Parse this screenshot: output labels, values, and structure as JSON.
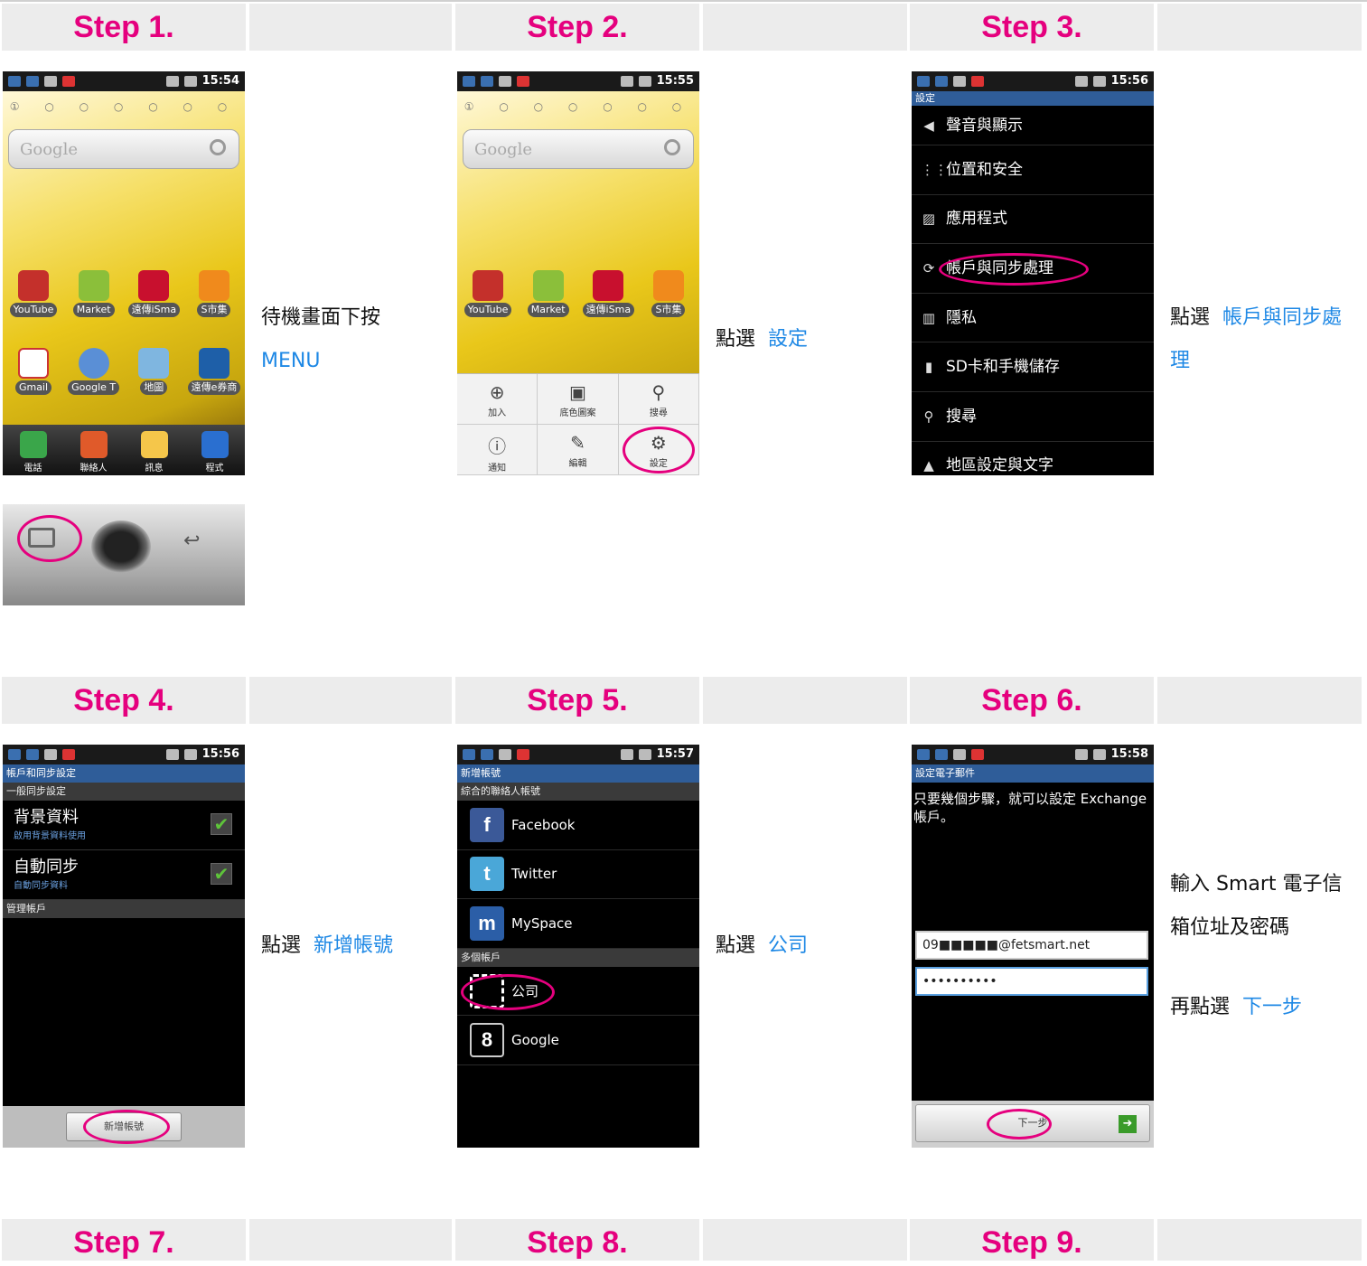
{
  "steps": [
    {
      "title": "Step 1.",
      "caption_prefix": "待機畫面下按",
      "caption_link": "MENU"
    },
    {
      "title": "Step 2.",
      "caption_prefix": "點選",
      "caption_link": "設定"
    },
    {
      "title": "Step 3.",
      "caption_prefix": "點選",
      "caption_link": "帳戶與同步處理"
    },
    {
      "title": "Step 4.",
      "caption_prefix": "點選",
      "caption_link": "新增帳號"
    },
    {
      "title": "Step 5.",
      "caption_prefix": "點選",
      "caption_link": "公司"
    },
    {
      "title": "Step 6.",
      "caption_line1": "輸入 Smart 電子信箱位址及密碼",
      "caption_prefix": "再點選",
      "caption_link": "下一步"
    },
    {
      "title": "Step 7."
    },
    {
      "title": "Step 8."
    },
    {
      "title": "Step 9."
    }
  ],
  "status_times": [
    "15:54",
    "15:55",
    "15:56",
    "15:56",
    "15:57",
    "15:58"
  ],
  "home": {
    "search_placeholder": "Google",
    "page_dots": "① ○ ○ ○ ○ ○ ○",
    "row1": [
      "YouTube",
      "Market",
      "遠傳iSma",
      "S市集"
    ],
    "row2": [
      "Gmail",
      "Google T",
      "地圖",
      "遠傳e券商"
    ],
    "dock": [
      "電話",
      "聯絡人",
      "訊息",
      "程式"
    ]
  },
  "menu_items": [
    "加入",
    "底色圖案",
    "搜尋",
    "通知",
    "編輯",
    "設定"
  ],
  "settings": {
    "title": "設定",
    "items": [
      "聲音與顯示",
      "位置和安全",
      "應用程式",
      "帳戶與同步處理",
      "隱私",
      "SD卡和手機儲存",
      "搜尋",
      "地區設定與文字"
    ]
  },
  "sync": {
    "title": "帳戶和同步設定",
    "section1": "一般同步設定",
    "bg_label": "背景資料",
    "bg_sub": "啟用背景資料使用",
    "auto_label": "自動同步",
    "auto_sub": "自動同步資料",
    "section2": "管理帳戶",
    "button": "新增帳號"
  },
  "accounts": {
    "title": "新增帳號",
    "section1": "綜合的聯絡人帳號",
    "list1": [
      "Facebook",
      "Twitter",
      "MySpace"
    ],
    "section2": "多個帳戶",
    "list2": [
      "公司",
      "Google"
    ]
  },
  "email": {
    "title": "設定電子郵件",
    "message": "只要幾個步驟，就可以設定 Exchange 帳戶。",
    "email_value": "09■■■■■@fetsmart.net",
    "password_value": "••••••••••",
    "next": "下一步"
  },
  "colors": {
    "accent": "#e5007e",
    "link": "#1e88e5"
  }
}
